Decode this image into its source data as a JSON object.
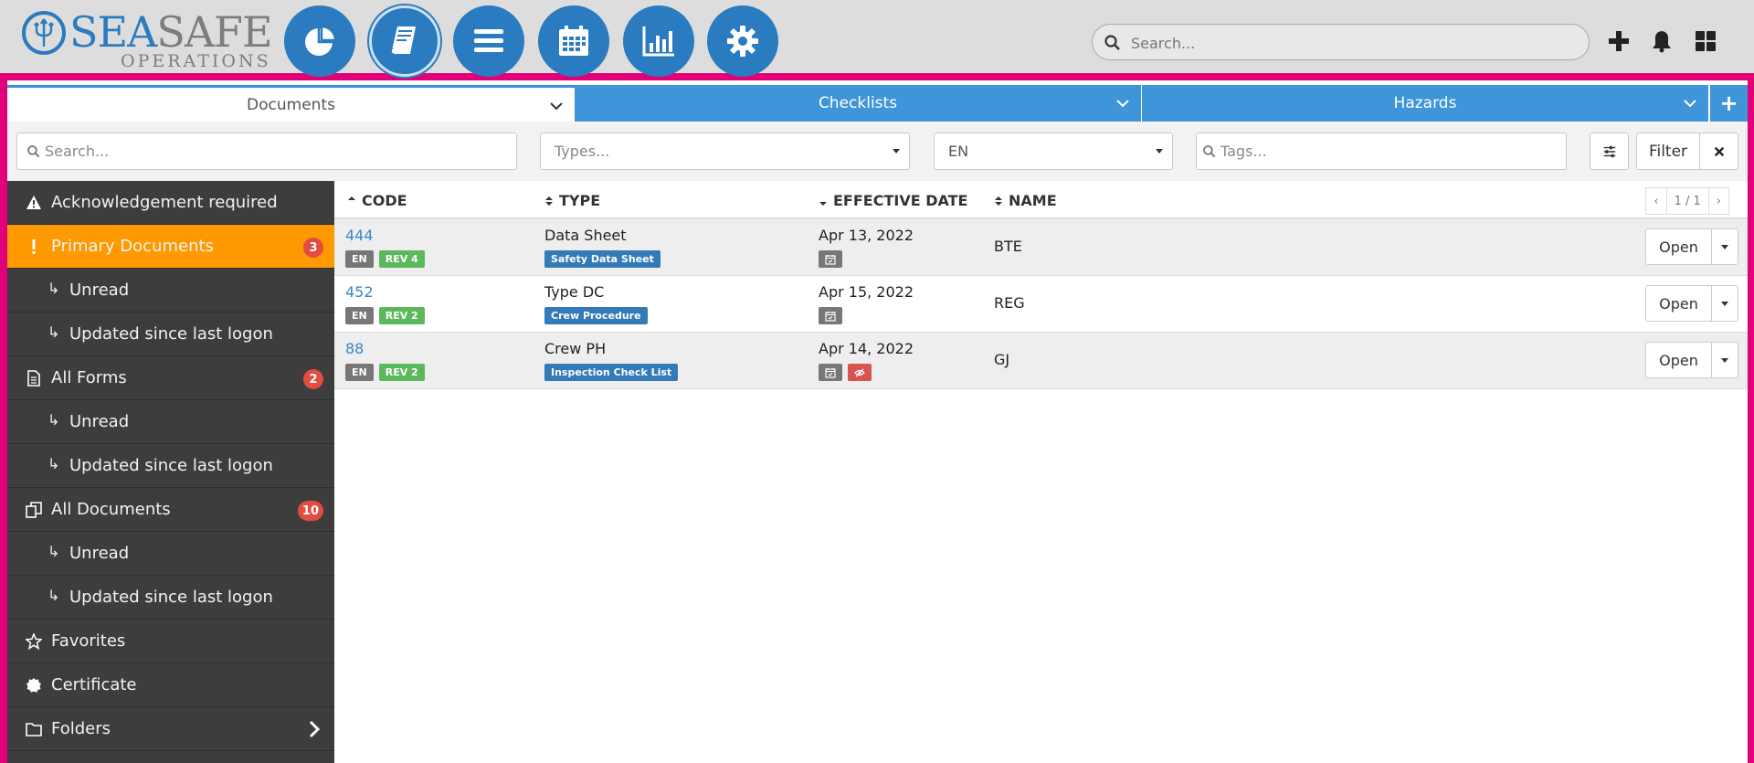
{
  "brand": {
    "sea": "SEA",
    "safe": "SAFE",
    "sub": "OPERATIONS"
  },
  "nav_icons": [
    "pie-chart-icon",
    "manual-book-icon",
    "menu-icon",
    "calendar-icon",
    "bar-chart-icon",
    "gear-icon"
  ],
  "top_search": {
    "placeholder": "Search..."
  },
  "top_actions": [
    "plus-icon",
    "bell-icon",
    "grid-icon"
  ],
  "tabs": [
    {
      "label": "Documents",
      "active": true
    },
    {
      "label": "Checklists",
      "active": false
    },
    {
      "label": "Hazards",
      "active": false
    },
    {
      "label": "+"
    }
  ],
  "filters": {
    "search_placeholder": "Search...",
    "types_placeholder": "Types...",
    "language_value": "EN",
    "tags_placeholder": "Tags...",
    "filter_label": "Filter"
  },
  "sidebar": {
    "items": [
      {
        "label": "Acknowledgement required",
        "icon": "warning-icon"
      },
      {
        "label": "Primary Documents",
        "icon": "exclamation-icon",
        "badge": "3",
        "active": true
      },
      {
        "label": "Unread",
        "sub": true
      },
      {
        "label": "Updated since last logon",
        "sub": true
      },
      {
        "label": "All Forms",
        "icon": "document-icon",
        "badge": "2"
      },
      {
        "label": "Unread",
        "sub": true
      },
      {
        "label": "Updated since last logon",
        "sub": true
      },
      {
        "label": "All Documents",
        "icon": "copy-icon",
        "badge": "10"
      },
      {
        "label": "Unread",
        "sub": true
      },
      {
        "label": "Updated since last logon",
        "sub": true
      },
      {
        "label": "Favorites",
        "icon": "star-icon"
      },
      {
        "label": "Certificate",
        "icon": "certificate-icon"
      },
      {
        "label": "Folders",
        "icon": "folder-icon"
      }
    ],
    "sub_arrow": "↳"
  },
  "table": {
    "headers": {
      "code": "CODE",
      "type": "TYPE",
      "effective_date": "EFFECTIVE DATE",
      "name": "NAME"
    },
    "pager": {
      "prev": "‹",
      "page": "1 / 1",
      "next": "›"
    },
    "open_label": "Open",
    "rows": [
      {
        "code": "444",
        "lang": "EN",
        "rev": "REV 4",
        "type": "Data Sheet",
        "type_tag": "Safety Data Sheet",
        "date": "Apr 13, 2022",
        "name": "BTE",
        "hidden_flag": false
      },
      {
        "code": "452",
        "lang": "EN",
        "rev": "REV 2",
        "type": "Type DC",
        "type_tag": "Crew Procedure",
        "date": "Apr 15, 2022",
        "name": "REG",
        "hidden_flag": false
      },
      {
        "code": "88",
        "lang": "EN",
        "rev": "REV 2",
        "type": "Crew PH",
        "type_tag": "Inspection Check List",
        "date": "Apr 14, 2022",
        "name": "GJ",
        "hidden_flag": true
      }
    ]
  },
  "colors": {
    "brand_blue": "#2a7bbf",
    "tab_blue": "#3f95d9",
    "sidebar_bg": "#3d3d3d",
    "active_orange": "#ff9900",
    "badge_red": "#e24c41",
    "frame_magenta": "#e0007a"
  }
}
